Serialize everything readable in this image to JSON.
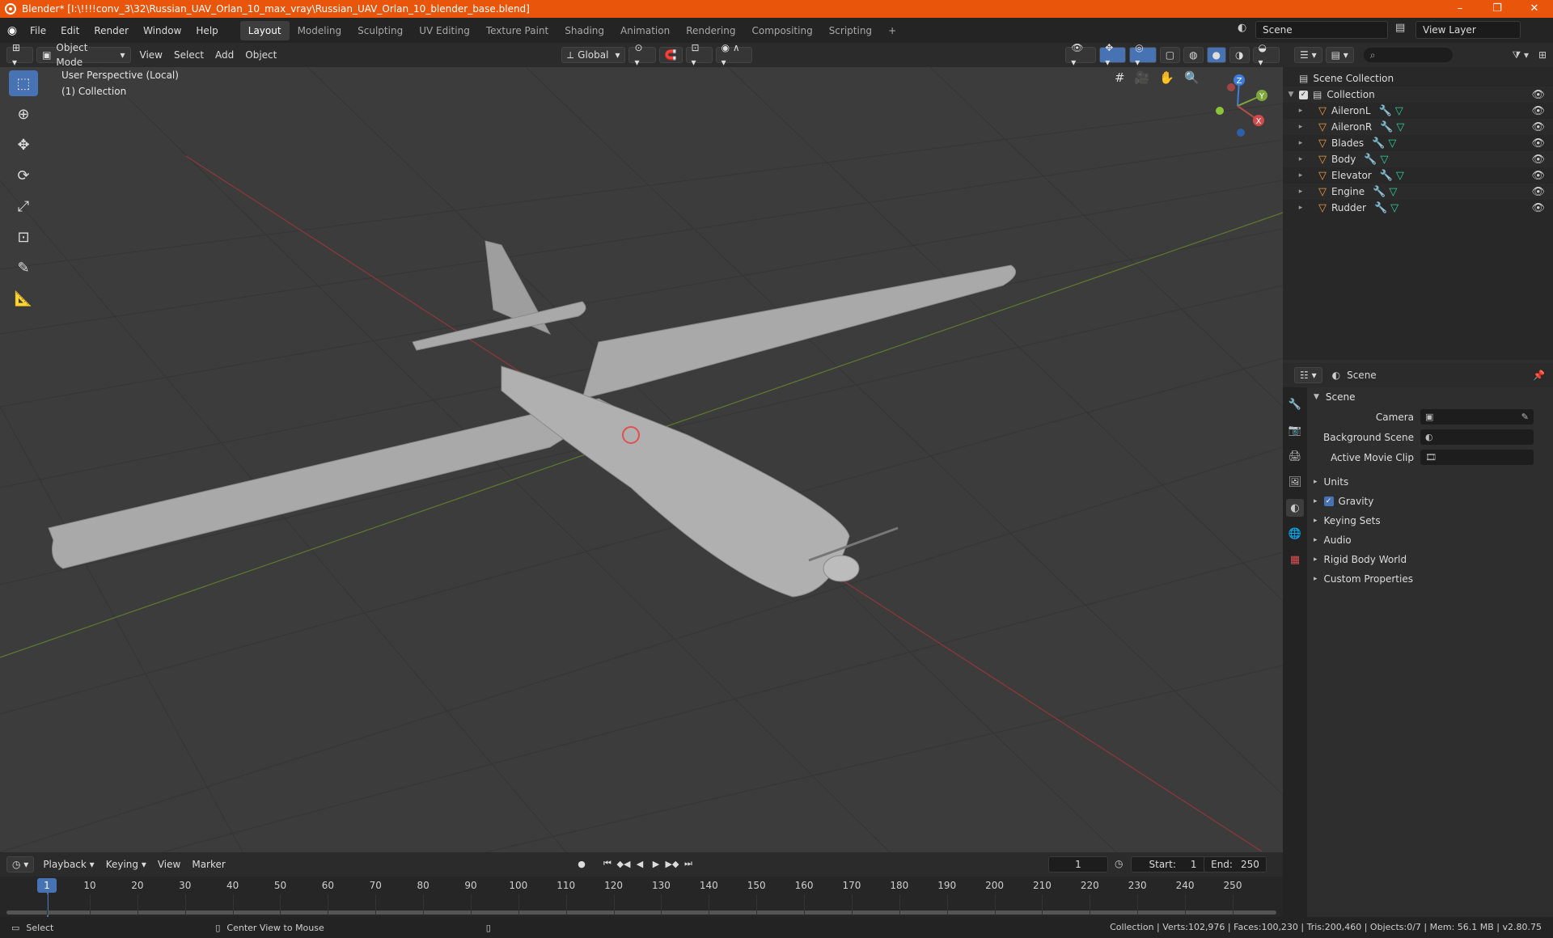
{
  "window": {
    "title": "Blender* [I:\\!!!!conv_3\\32\\Russian_UAV_Orlan_10_max_vray\\Russian_UAV_Orlan_10_blender_base.blend]",
    "controls": [
      "–",
      "❐",
      "✕"
    ]
  },
  "menus": [
    "File",
    "Edit",
    "Render",
    "Window",
    "Help"
  ],
  "workspaces": [
    {
      "label": "Layout",
      "active": true
    },
    {
      "label": "Modeling"
    },
    {
      "label": "Sculpting"
    },
    {
      "label": "UV Editing"
    },
    {
      "label": "Texture Paint"
    },
    {
      "label": "Shading"
    },
    {
      "label": "Animation"
    },
    {
      "label": "Rendering"
    },
    {
      "label": "Compositing"
    },
    {
      "label": "Scripting"
    }
  ],
  "scene_selector": "Scene",
  "view_layer_selector": "View Layer",
  "viewport_header": {
    "mode": "Object Mode",
    "menus": [
      "View",
      "Select",
      "Add",
      "Object"
    ],
    "transform_orientation": "Global"
  },
  "viewport": {
    "perspective": "User Perspective (Local)",
    "collection": "(1) Collection",
    "gizmo_axes": [
      "Z",
      "Y",
      "X"
    ],
    "colors": {
      "x_axis": "#b54a4a",
      "y_axis": "#7fa63c",
      "z_axis": "#3d7de0",
      "background": "#3c3c3c"
    }
  },
  "outliner": {
    "root": "Scene Collection",
    "collection": "Collection",
    "objects": [
      "AileronL",
      "AileronR",
      "Blades",
      "Body",
      "Elevator",
      "Engine",
      "Rudder"
    ]
  },
  "properties": {
    "context": "Scene",
    "panel": "Scene",
    "fields": [
      {
        "label": "Camera"
      },
      {
        "label": "Background Scene"
      },
      {
        "label": "Active Movie Clip"
      }
    ],
    "subpanels": [
      {
        "label": "Units"
      },
      {
        "label": "Gravity",
        "checked": true
      },
      {
        "label": "Keying Sets"
      },
      {
        "label": "Audio"
      },
      {
        "label": "Rigid Body World"
      },
      {
        "label": "Custom Properties"
      }
    ]
  },
  "timeline": {
    "menus": [
      "Playback",
      "Keying",
      "View",
      "Marker"
    ],
    "current_frame": "1",
    "start_label": "Start:",
    "start": "1",
    "end_label": "End:",
    "end": "250",
    "ticks": [
      "1",
      "10",
      "20",
      "30",
      "40",
      "50",
      "60",
      "70",
      "80",
      "90",
      "100",
      "110",
      "120",
      "130",
      "140",
      "150",
      "160",
      "170",
      "180",
      "190",
      "200",
      "210",
      "220",
      "230",
      "240",
      "250"
    ]
  },
  "statusbar": {
    "left_action": "Select",
    "middle_action": "Center View to Mouse",
    "stats": "Collection | Verts:102,976 | Faces:100,230 | Tris:200,460 | Objects:0/7 | Mem: 56.1 MB | v2.80.75"
  }
}
